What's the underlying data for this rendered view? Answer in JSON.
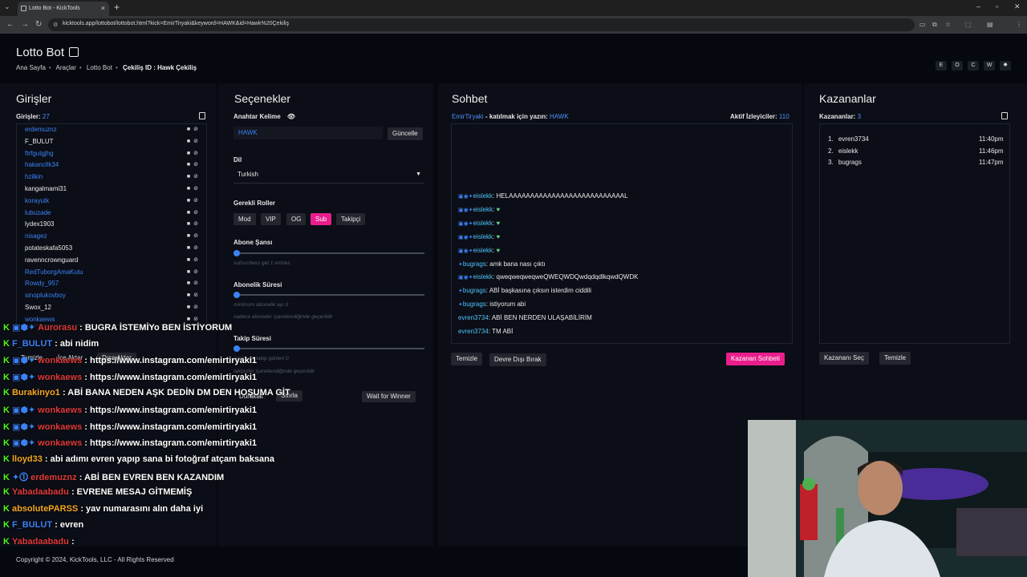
{
  "browser": {
    "tab_title": "Lotto Bot - KickTools",
    "url": "kicktools.app/lottobot/lottobot.html?kick=EmirTiryaki&keyword=HAWK&id=Hawk%20Çekiliş"
  },
  "header": {
    "title": "Lotto Bot",
    "breadcrumb": [
      "Ana Sayfa",
      "Araçlar",
      "Lotto Bot"
    ],
    "giveaway_id_label": "Çekiliş ID :",
    "giveaway_id_value": "Hawk Çekiliş",
    "top_icons": [
      "E",
      "O",
      "C",
      "W",
      "✸"
    ]
  },
  "entries": {
    "title": "Girişler",
    "count_label": "Girişler:",
    "count": "27",
    "list": [
      {
        "name": "erdemuznz",
        "color": "#3b82f6"
      },
      {
        "name": "F_BULUT",
        "color": "#eaeaea"
      },
      {
        "name": "ftrfgutgjhg",
        "color": "#3b82f6"
      },
      {
        "name": "hakancllk34",
        "color": "#3b82f6"
      },
      {
        "name": "hzilkin",
        "color": "#3b82f6"
      },
      {
        "name": "kangalmami31",
        "color": "#eaeaea"
      },
      {
        "name": "korayutk",
        "color": "#3b82f6"
      },
      {
        "name": "lubuzade",
        "color": "#3b82f6"
      },
      {
        "name": "lydex1903",
        "color": "#eaeaea"
      },
      {
        "name": "nisagez",
        "color": "#3b82f6"
      },
      {
        "name": "potateskafa5053",
        "color": "#eaeaea"
      },
      {
        "name": "ravenncrownguard",
        "color": "#eaeaea"
      },
      {
        "name": "RedTuborgAmaKutu",
        "color": "#3b82f6"
      },
      {
        "name": "Rowdy_957",
        "color": "#3b82f6"
      },
      {
        "name": "sinoplukovboy",
        "color": "#3b82f6"
      },
      {
        "name": "Swox_12",
        "color": "#eaeaea"
      },
      {
        "name": "wonkaews",
        "color": "#3b82f6"
      }
    ],
    "buttons": {
      "clear": "Temizle",
      "import": "İçe Aktar",
      "export": "Dışa Aktar"
    }
  },
  "options": {
    "title": "Seçenekler",
    "keyword_label": "Anahtar Kelime",
    "keyword_value": "HAWK",
    "update_button": "Güncelle",
    "language_label": "Dil",
    "language_value": "Turkish",
    "roles_label": "Gerekli Roller",
    "roles": [
      {
        "label": "Mod",
        "active": false
      },
      {
        "label": "VIP",
        "active": false
      },
      {
        "label": "OG",
        "active": false
      },
      {
        "label": "Sub",
        "active": true
      },
      {
        "label": "Takipçi",
        "active": false
      }
    ],
    "sub_chance_label": "Abone Şansı",
    "sub_chance_hint": "subscribers get 1 entries",
    "sub_duration_label": "Abonelik Süresi",
    "sub_duration_hint1": "minimum abonelik ayı 0",
    "sub_duration_hint2": "sadece aboneler işaretlendiğinde geçerlidir",
    "follow_duration_label": "Takip Süresi",
    "follow_duration_hint1": "minimum takip günleri 0",
    "follow_duration_hint2": "takipçiler işaretlendiğinde geçerlidir",
    "pause_button": "Duraklat",
    "reset_button": "Sıfırla",
    "wait_button": "Wait for Winner"
  },
  "chat": {
    "title": "Sohbet",
    "streamer": "EmirTiryaki",
    "join_text": "- katılmak için yazın:",
    "keyword": "HAWK",
    "viewers_label": "Aktif İzleyiciler:",
    "viewers": "110",
    "messages": [
      {
        "badges": "▣◉✦",
        "user": "eislekk",
        "text": "HELAAAAAAAAAAAAAAAAAAAAAAAAAAAL",
        "heart": false
      },
      {
        "badges": "▣◉✦",
        "user": "eislekk",
        "text": "",
        "heart": true
      },
      {
        "badges": "▣◉✦",
        "user": "eislekk",
        "text": "",
        "heart": true
      },
      {
        "badges": "▣◉✦",
        "user": "eislekk",
        "text": "",
        "heart": true
      },
      {
        "badges": "▣◉✦",
        "user": "eislekk",
        "text": "",
        "heart": true
      },
      {
        "badges": "✦",
        "user": "bugrags",
        "text": "amk bana nası çıktı",
        "heart": false
      },
      {
        "badges": "▣◉✦",
        "user": "eislekk",
        "text": "qweqweqweqweQWEQWDQwdqdqdlkqwdQWDK",
        "heart": false
      },
      {
        "badges": "✦",
        "user": "bugrags",
        "text": "ABİ başkasına çıksın isterdim ciddili",
        "heart": false
      },
      {
        "badges": "✦",
        "user": "bugrags",
        "text": "istiyorum abi",
        "heart": false
      },
      {
        "badges": "",
        "user": "evren3734",
        "text": "ABİ BEN NERDEN ULAŞABİLİRİM",
        "heart": false
      },
      {
        "badges": "",
        "user": "evren3734",
        "text": "TM ABİ",
        "heart": false
      }
    ],
    "clear_button": "Temizle",
    "disable_button": "Devre Dışı Bırak",
    "winner_chat_button": "Kazanan Sohbeti"
  },
  "winners": {
    "title": "Kazananlar",
    "count_label": "Kazananlar:",
    "count": "3",
    "list": [
      {
        "rank": "1.",
        "name": "evren3734",
        "time": "11:40pm"
      },
      {
        "rank": "2.",
        "name": "eislekk",
        "time": "11:46pm"
      },
      {
        "rank": "3.",
        "name": "bugrags",
        "time": "11:47pm"
      }
    ],
    "pick_button": "Kazananı Seç",
    "clear_button": "Temizle"
  },
  "overlay_chat": [
    {
      "badges": "▣⬢✦",
      "user": "Aurorasu",
      "user_color": "#e03a3a",
      "text": ": BUGRA İSTEMİYo BEN İSTİYORUM"
    },
    {
      "badges": "",
      "user": "F_BULUT",
      "user_color": "#3b82f6",
      "text": ": abi nidim"
    },
    {
      "badges": "▣⬢✦",
      "user": "wonkaews",
      "user_color": "#e03a3a",
      "text": ": https://www.instagram.com/emirtiryaki1"
    },
    {
      "badges": "▣⬢✦",
      "user": "wonkaews",
      "user_color": "#e03a3a",
      "text": ": https://www.instagram.com/emirtiryaki1"
    },
    {
      "badges": "",
      "user": "Burakinyo1",
      "user_color": "#f5a623",
      "text": ": ABİ BANA NEDEN AŞK DEDİN DM DEN HOŞUMA GİT"
    },
    {
      "badges": "▣⬢✦",
      "user": "wonkaews",
      "user_color": "#e03a3a",
      "text": ": https://www.instagram.com/emirtiryaki1"
    },
    {
      "badges": "▣⬢✦",
      "user": "wonkaews",
      "user_color": "#e03a3a",
      "text": ": https://www.instagram.com/emirtiryaki1"
    },
    {
      "badges": "▣⬢✦",
      "user": "wonkaews",
      "user_color": "#e03a3a",
      "text": ": https://www.instagram.com/emirtiryaki1"
    },
    {
      "badges": "",
      "user": "lloyd33",
      "user_color": "#f5a623",
      "text": ": abi adımı evren yapıp sana bi fotoğraf atçam baksana"
    },
    {
      "badges": "✦⓵",
      "user": "erdemuznz",
      "user_color": "#e03a3a",
      "text": ": ABİ BEN EVREN BEN KAZANDIM"
    },
    {
      "badges": "",
      "user": "Yabadaabadu",
      "user_color": "#e03a3a",
      "text": ": EVRENE MESAJ GİTMEMİŞ"
    },
    {
      "badges": "",
      "user": "absolutePARSS",
      "user_color": "#f5a623",
      "text": ": yav numarasını alın daha iyi"
    },
    {
      "badges": "",
      "user": "F_BULUT",
      "user_color": "#3b82f6",
      "text": ": evren"
    },
    {
      "badges": "",
      "user": "Yabadaabadu",
      "user_color": "#e03a3a",
      "text": ":"
    }
  ],
  "footer": "Copyright © 2024, KickTools, LLC - All Rights Reserved"
}
